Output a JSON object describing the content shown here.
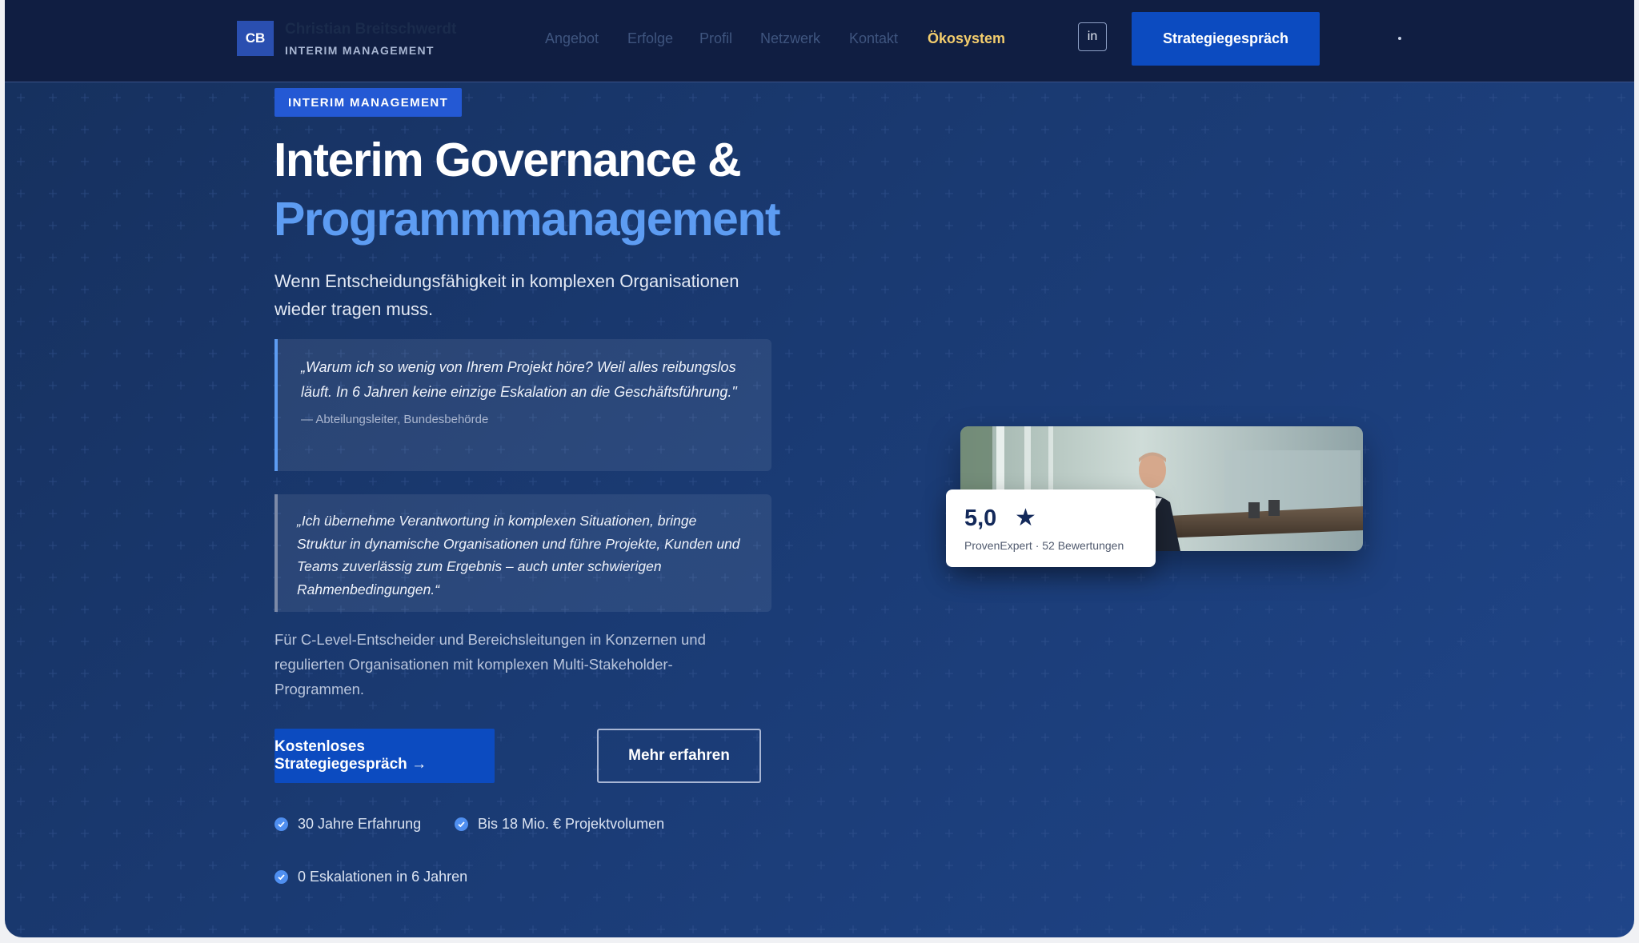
{
  "nav": {
    "logo_initials": "CB",
    "brand_name": "Christian Breitschwerdt",
    "brand_sub": "INTERIM MANAGEMENT",
    "links": [
      "Angebot",
      "Erfolge",
      "Profil",
      "Netzwerk",
      "Kontakt",
      "Ökosystem"
    ],
    "linkedin": "in",
    "cta": "Strategiegespräch"
  },
  "hero": {
    "badge": "INTERIM MANAGEMENT",
    "headline_line1": "Interim Governance &",
    "headline_line2": "Programmmanagement",
    "subtitle": "Wenn Entscheidungsfähigkeit in komplexen Organisationen wieder tragen muss.",
    "quote1_text": "„Warum ich so wenig von Ihrem Projekt höre? Weil alles reibungslos läuft. In 6 Jahren keine einzige Eskalation an die Geschäftsführung.\"",
    "quote1_source": "— Abteilungsleiter, Bundesbehörde",
    "quote2_text": "„Ich übernehme Verantwortung in komplexen Situationen, bringe Struktur in dynamische Organisationen und führe Projekte, Kunden und Teams zuverlässig zum Ergebnis – auch unter schwierigen Rahmenbedingungen.“",
    "target_text": "Für C-Level-Entscheider und Bereichsleitungen in Konzernen und regulierten Organisationen mit komplexen Multi-Stakeholder-Programmen.",
    "cta_primary": "Kostenloses Strategiegespräch →",
    "cta_secondary": "Mehr erfahren",
    "checks": [
      "30 Jahre Erfahrung",
      "Bis 18 Mio. € Projektvolumen",
      "0 Eskalationen in 6 Jahren"
    ]
  },
  "rating": {
    "value": "5,0",
    "source": "ProvenExpert · 52 Bewertungen"
  },
  "colors": {
    "accent": "#0c4bc0",
    "highlight": "#5d9cf2",
    "nav_active": "#f3cd6d"
  }
}
